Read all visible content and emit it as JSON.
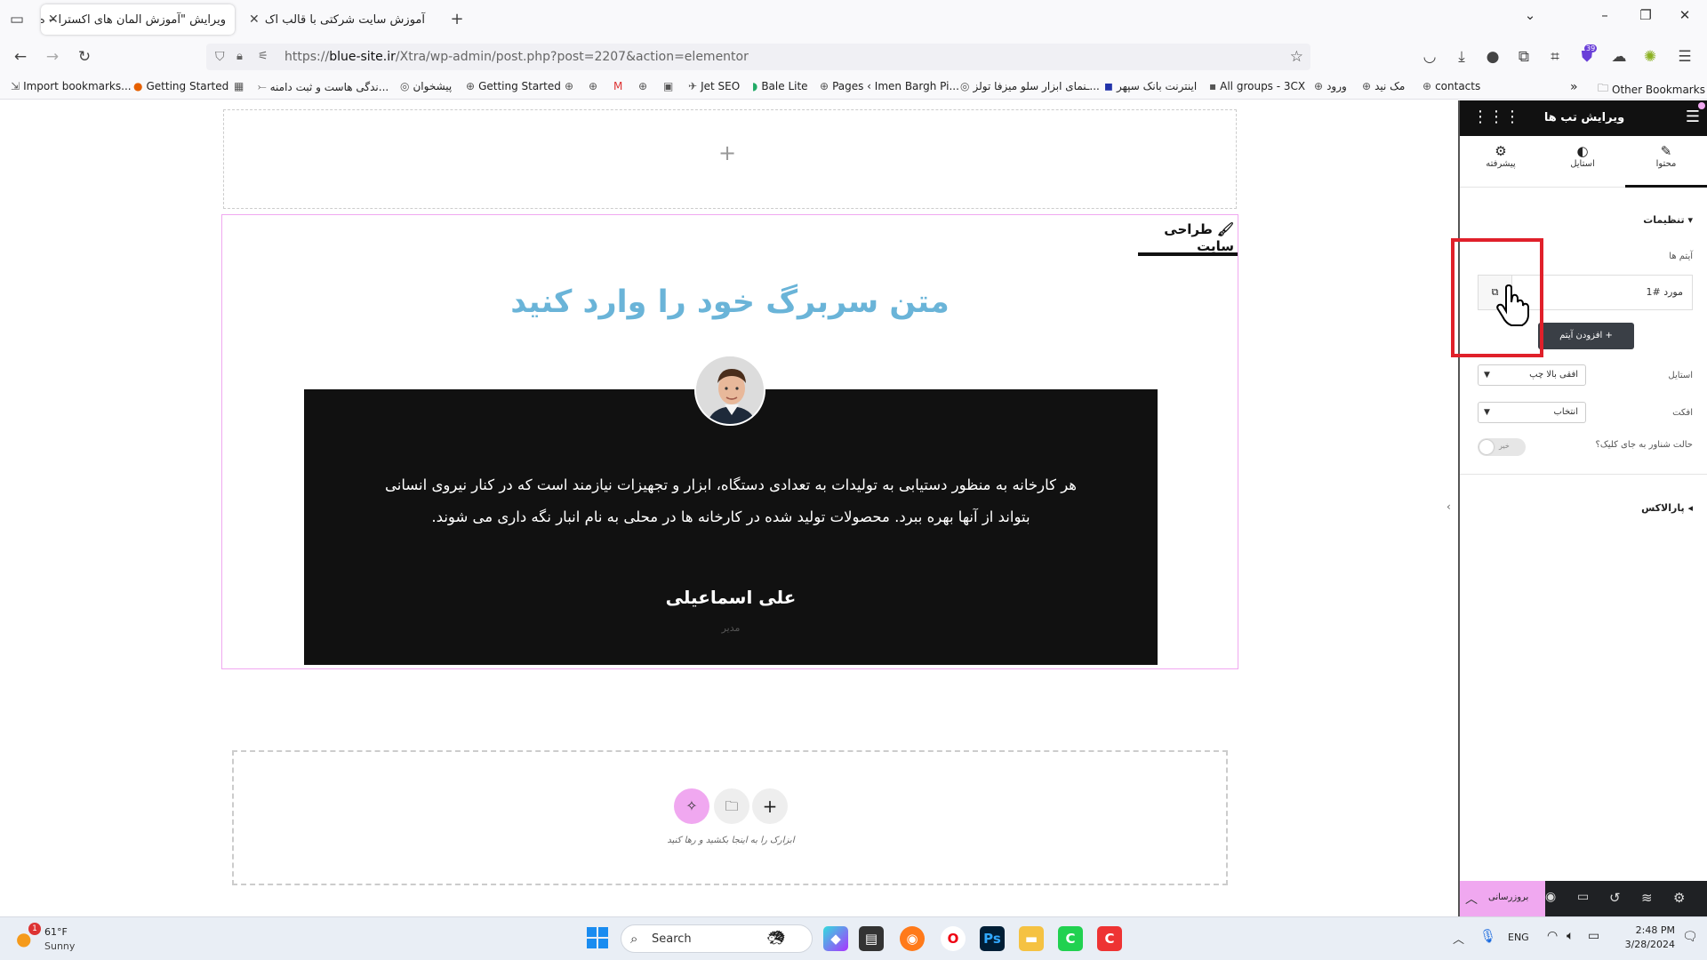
{
  "browser": {
    "tabs": [
      {
        "title": "ویرایش \"آموزش المان های اکسترا – ه",
        "active": true
      },
      {
        "title": "آموزش سایت شرکتی با قالب اک",
        "active": false
      }
    ],
    "new_tab": "+",
    "url_prefix": "https://",
    "url_domain": "blue-site.ir",
    "url_path": "/Xtra/wp-admin/post.php?post=2207&action=elementor",
    "extension_badge": "39"
  },
  "bookmarks": {
    "items": [
      "Import bookmarks...",
      "Getting Started",
      "ندگی هاست و ثبت دامنه...",
      "پیشخوان",
      "Getting Started",
      "Jet SEO",
      "Bale Lite",
      "Pages ‹ Imen Bargh Pi...",
      "ـنمای ابزار سلو میزفا تولز...",
      "اینترنت بانک سپهر",
      "All groups - 3CX",
      "ورود",
      "مک نید",
      "contacts"
    ],
    "more": "»",
    "other": "Other Bookmarks"
  },
  "canvas": {
    "add_symbol": "+",
    "tab_title": "طراحی سایت",
    "heading": "متن سربرگ خود را وارد کنید",
    "testimonial_text": "هر کارخانه به منظور دستیابی به تولیدات به تعدادی دستگاه، ابزار و تجهیزات نیازمند است که در کنار نیروی انسانی بتواند از آنها بهره ببرد. محصولات تولید شده در کارخانه ها در محلی به نام انبار نگه داری می شوند.",
    "testimonial_name": "علی اسماعیلی",
    "testimonial_role": "مدیر",
    "drop_hint": "ابزارک را به اینجا بکشید و رها کنید"
  },
  "panel": {
    "title": "ویرایش تب ها",
    "tabs": [
      {
        "label": "محتوا",
        "icon": "pencil-icon",
        "active": true
      },
      {
        "label": "استایل",
        "icon": "half-circle-icon",
        "active": false
      },
      {
        "label": "پیشرفته",
        "icon": "gear-icon",
        "active": false
      }
    ],
    "section_settings": "تنظیمات",
    "items_label": "آیتم ها",
    "item_1": "مورد #1",
    "add_item": "افزودن آیتم",
    "style_label": "استایل",
    "style_value": "افقی بالا چپ",
    "effect_label": "افکت",
    "effect_value": "انتخاب",
    "hover_label": "حالت شناور به جای کلیک؟",
    "hover_toggle": "خیر",
    "parallax": "پارالاکس",
    "publish": "بروزرسانی"
  },
  "taskbar": {
    "weather_temp": "61°F",
    "weather_desc": "Sunny",
    "weather_badge": "1",
    "search": "Search",
    "lang": "ENG",
    "time": "2:48 PM",
    "date": "3/28/2024"
  },
  "colors": {
    "accent_pink": "#f0a8f0",
    "heading_blue": "#6ab4d8",
    "highlight_red": "#e0202a",
    "panel_header": "#111111"
  }
}
